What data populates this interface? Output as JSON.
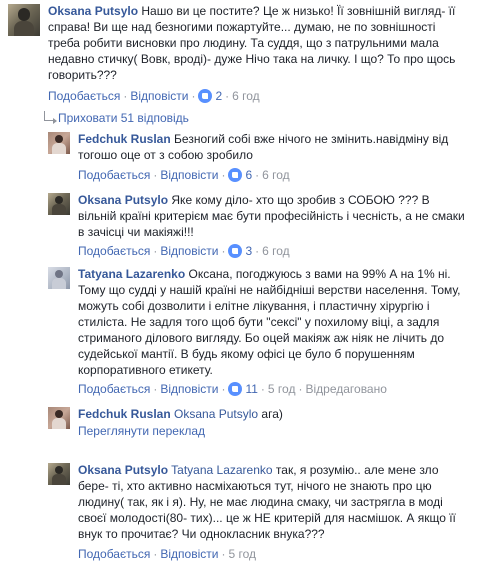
{
  "main_comment": {
    "author": "Oksana Putsylo",
    "text": "Нашо ви це постите? Це ж низько! Її зовнішній вигляд- її справа! Ви ще над безногими пожартуйте... думаю, не по зовнішності треба робити висновки про людину. Та суддя, що з патрульними мала недавно стичку( Вовк, вроді)- дуже Нічо така на личку. І що? То про щось говорить???",
    "like_label": "Подобається",
    "reply_label": "Відповісти",
    "reactions": "2",
    "time": "6 год"
  },
  "replies_toggle": "Приховати 51 відповідь",
  "replies": [
    {
      "author": "Fedchuk Ruslan",
      "text": "Безногий собі вже нічого не змінить.навідміну від тогошо оце от з собою зробило",
      "like_label": "Подобається",
      "reply_label": "Відповісти",
      "reactions": "6",
      "time": "6 год"
    },
    {
      "author": "Oksana Putsylo",
      "text": "Яке кому діло- хто що зробив з СОБОЮ ??? В вільній країні критерієм має бути професійність і чесність, а не смаки в зачісці чи макіяжі!!!",
      "like_label": "Подобається",
      "reply_label": "Відповісти",
      "reactions": "3",
      "time": "6 год"
    },
    {
      "author": "Tatyana Lazarenko",
      "text": "Оксана, погоджуюсь з вами на 99% А на 1% ні. Тому що судді у нашій країні не найбідніші верстви населення. Тому, можуть собі дозволити і елітне лікування, і пластичну хірургію і стилістa. Не задля того щоб бути \"сексі\" у похилому віці, а задля стриманого ділового вигляду. Бо оцей макіяж аж ніяк не лічить до судейської мантії. В будь якому офісі це було б порушенням корпоративного етикету.",
      "like_label": "Подобається",
      "reply_label": "Відповісти",
      "reactions": "11",
      "time": "5 год",
      "edited": "Відредаговано"
    },
    {
      "author": "Fedchuk Ruslan",
      "mention": "Oksana Putsylo",
      "text": "ага)",
      "translate": "Переглянути переклад"
    },
    {
      "author": "Oksana Putsylo",
      "mention": "Tatyana Lazarenko",
      "text": "так, я розумію.. але мене зло бере- ті, хто активно насміхаються тут, нічого не знають про цю людину( так, як і я). Ну, не має людина смаку, чи застрягла в моді своєї молодості(80- тих)... це ж НЕ критерій для насмішок. А якщо її внук то прочитає? Чи однокласник внука???",
      "like_label": "Подобається",
      "reply_label": "Відповісти",
      "time": "5 год"
    }
  ]
}
